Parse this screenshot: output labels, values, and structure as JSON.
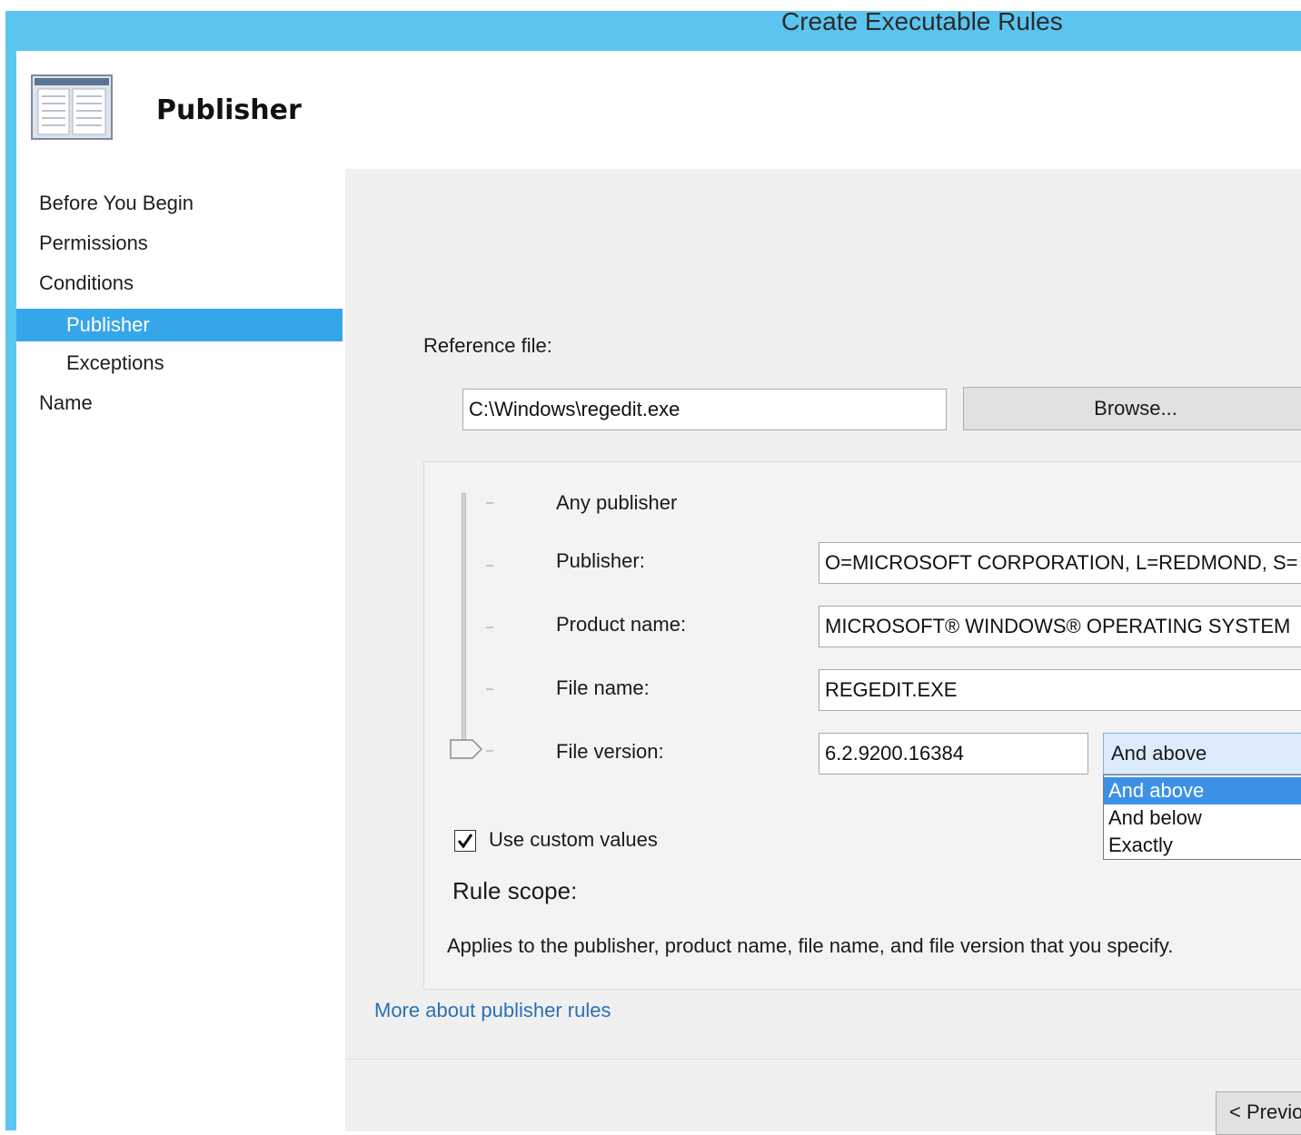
{
  "window": {
    "title": "Create Executable Rules"
  },
  "header": {
    "title": "Publisher",
    "icon": "rule-page-icon"
  },
  "nav": {
    "items": [
      {
        "label": "Before You Begin",
        "indent": false,
        "selected": false
      },
      {
        "label": "Permissions",
        "indent": false,
        "selected": false
      },
      {
        "label": "Conditions",
        "indent": false,
        "selected": false
      },
      {
        "label": "Publisher",
        "indent": true,
        "selected": true
      },
      {
        "label": "Exceptions",
        "indent": true,
        "selected": false
      },
      {
        "label": "Name",
        "indent": false,
        "selected": false
      }
    ]
  },
  "reference": {
    "label": "Reference file:",
    "value": "C:\\Windows\\regedit.exe",
    "browse_label": "Browse..."
  },
  "rule_levels": {
    "any_publisher": "Any publisher",
    "publisher_label": "Publisher:",
    "publisher_value": "O=MICROSOFT CORPORATION, L=REDMOND, S=",
    "product_label": "Product name:",
    "product_value": "MICROSOFT® WINDOWS® OPERATING SYSTEM",
    "filename_label": "File name:",
    "filename_value": "REGEDIT.EXE",
    "version_label": "File version:",
    "version_value": "6.2.9200.16384",
    "version_operator": "And above",
    "version_options": [
      "And above",
      "And below",
      "Exactly"
    ]
  },
  "custom_values": {
    "label": "Use custom values",
    "checked": true
  },
  "scope": {
    "label": "Rule scope:",
    "description": "Applies to the publisher, product name, file name, and file version that you specify."
  },
  "links": {
    "more_about": "More about publisher rules"
  },
  "footer": {
    "previous_label": "< Previous"
  },
  "colors": {
    "title_bar": "#5bc5ef",
    "nav_selected": "#36a6ea",
    "option_selected": "#3c91e6",
    "link": "#2a6fb8"
  }
}
